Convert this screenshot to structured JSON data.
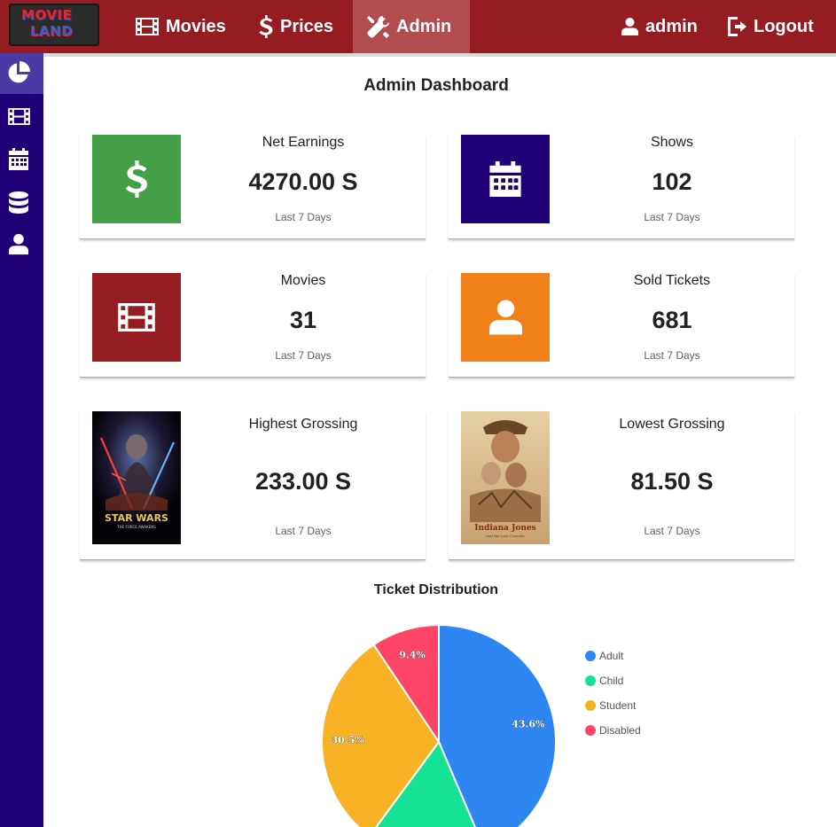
{
  "app": {
    "logo_line1": "MOVIE",
    "logo_line2": "LAND"
  },
  "nav": {
    "movies": "Movies",
    "prices": "Prices",
    "admin": "Admin",
    "user": "admin",
    "logout": "Logout"
  },
  "sidebar": {
    "items": [
      {
        "icon": "pie-chart-icon",
        "active": true
      },
      {
        "icon": "film-icon",
        "active": false
      },
      {
        "icon": "calendar-icon",
        "active": false
      },
      {
        "icon": "database-icon",
        "active": false
      },
      {
        "icon": "user-icon",
        "active": false
      }
    ]
  },
  "page": {
    "title": "Admin Dashboard"
  },
  "cards": {
    "net_earnings": {
      "label": "Net Earnings",
      "value": "4270.00 S",
      "sub": "Last 7 Days",
      "color": "#43a047",
      "icon": "dollar-icon"
    },
    "shows": {
      "label": "Shows",
      "value": "102",
      "sub": "Last 7 Days",
      "color": "#200077",
      "icon": "calendar-icon"
    },
    "movies": {
      "label": "Movies",
      "value": "31",
      "sub": "Last 7 Days",
      "color": "#951c20",
      "icon": "film-icon"
    },
    "sold_tickets": {
      "label": "Sold Tickets",
      "value": "681",
      "sub": "Last 7 Days",
      "color": "#f08017",
      "icon": "user-icon"
    },
    "highest_grossing": {
      "label": "Highest Grossing",
      "value": "233.00 S",
      "sub": "Last 7 Days",
      "poster": "poster-star-wars",
      "poster_title": "STAR WARS",
      "poster_subtitle": "THE FORCE AWAKENS"
    },
    "lowest_grossing": {
      "label": "Lowest Grossing",
      "value": "81.50 S",
      "sub": "Last 7 Days",
      "poster": "poster-indiana-jones",
      "poster_title": "Indiana Jones",
      "poster_subtitle": "and the Last Crusade"
    }
  },
  "chart_data": {
    "type": "pie",
    "title": "Ticket Distribution",
    "categories": [
      "Adult",
      "Child",
      "Student",
      "Disabled"
    ],
    "values": [
      43.6,
      16.5,
      30.5,
      9.4
    ],
    "value_labels": [
      "43.6%",
      "",
      "30.5%",
      "9.4%"
    ],
    "colors": [
      "#2e86f2",
      "#15e294",
      "#f9b126",
      "#ff4565"
    ],
    "legend_position": "right"
  }
}
